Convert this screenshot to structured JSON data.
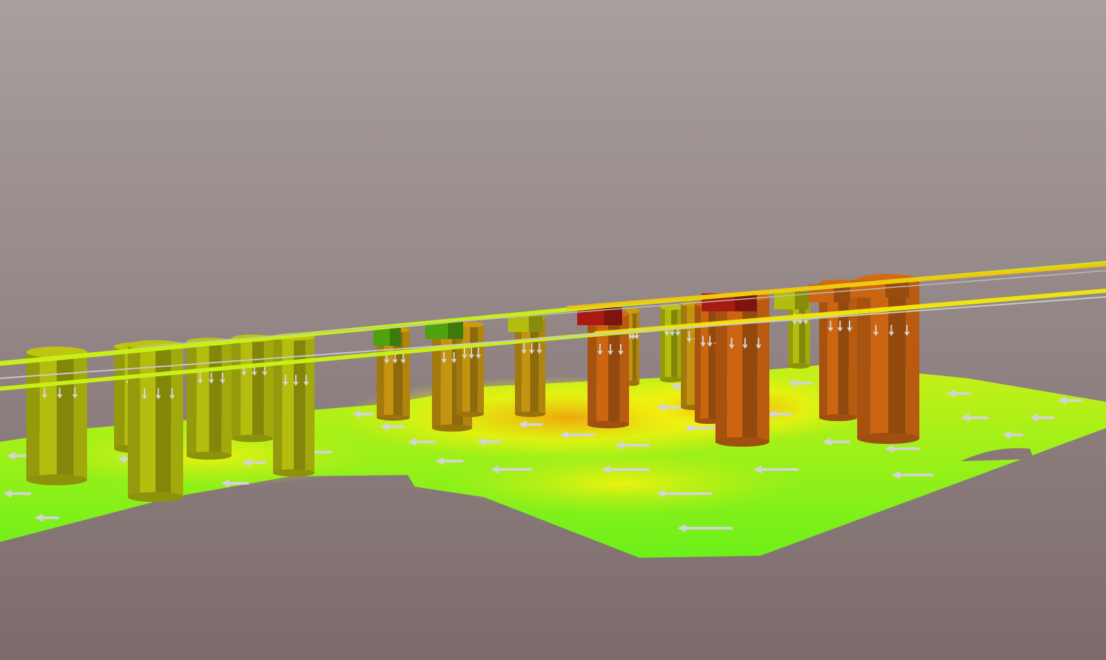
{
  "viewport": {
    "kind": "3d-scene",
    "content": "structural-analysis-result"
  },
  "colors": {
    "background_top": "#A99F9F",
    "background_bottom": "#7C6B6B",
    "slab_green": "#6CF01A",
    "slab_yellow_green": "#C8F018",
    "slab_yellow": "#F6F20E",
    "slab_orange": "#F2A40C",
    "column_olive": "#B4BC0E",
    "column_amber": "#C49310",
    "column_orange": "#CC6512",
    "column_green": "#4EA20E",
    "column_red": "#A81A12",
    "arrow": "#D4D4D4"
  },
  "icons": {
    "load_arrow": "arrow-icon"
  }
}
